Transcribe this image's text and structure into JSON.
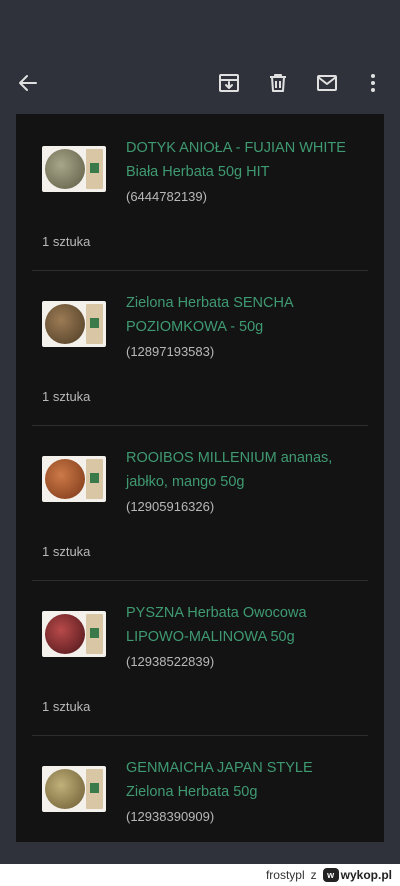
{
  "appbar": {
    "icons": [
      "back-arrow-icon",
      "archive-icon",
      "trash-icon",
      "mail-icon",
      "more-vert-icon"
    ]
  },
  "items": [
    {
      "title_line1": "DOTYK ANIOŁA - FUJIAN WHITE",
      "title_line2": "Biała Herbata 50g HIT",
      "code": "(6444782139)",
      "qty": "1 sztuka",
      "tea_color": "#7b7a5e"
    },
    {
      "title_line1": "Zielona Herbata SENCHA",
      "title_line2": "POZIOMKOWA - 50g",
      "code": "(12897193583)",
      "qty": "1 sztuka",
      "tea_color": "#6b5a3a"
    },
    {
      "title_line1": "ROOIBOS MILLENIUM ananas,",
      "title_line2": "jabłko, mango 50g",
      "code": "(12905916326)",
      "qty": "1 sztuka",
      "tea_color": "#a0522d"
    },
    {
      "title_line1": "PYSZNA Herbata Owocowa",
      "title_line2": "LIPOWO-MALINOWA 50g",
      "code": "(12938522839)",
      "qty": "1 sztuka",
      "tea_color": "#7a2a2a"
    },
    {
      "title_line1": "GENMAICHA JAPAN STYLE",
      "title_line2": "Zielona Herbata 50g",
      "code": "(12938390909)",
      "qty": "",
      "tea_color": "#8a7a4a"
    }
  ],
  "footer": {
    "user": "frostypl",
    "separator": "z",
    "brand": "wykop.pl"
  },
  "colors": {
    "accent_text": "#3f9a72",
    "background": "#131313",
    "chrome": "#2f323a"
  }
}
